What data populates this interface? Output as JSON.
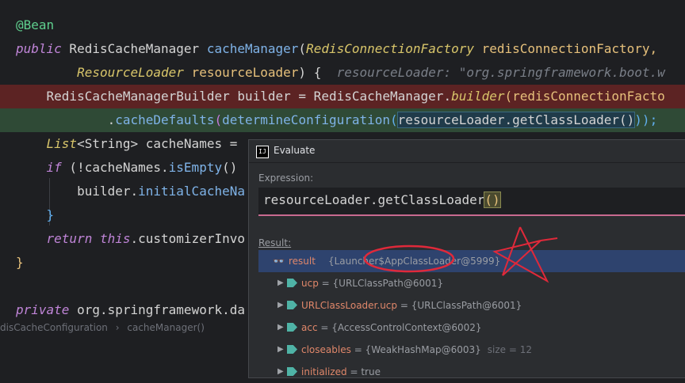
{
  "editor": {
    "lines": [
      {
        "parts": [
          {
            "t": "@Bean",
            "c": "ann"
          }
        ]
      },
      {
        "parts": [
          {
            "t": "public",
            "c": "kw"
          },
          {
            "t": " RedisCacheManager ",
            "c": "punct"
          },
          {
            "t": "cacheManager",
            "c": "method"
          },
          {
            "t": "(",
            "c": "punct"
          },
          {
            "t": "RedisConnectionFactory",
            "c": "type"
          },
          {
            "t": " redisConnectionFactory,",
            "c": "ident"
          }
        ]
      },
      {
        "parts": [
          {
            "t": "        "
          },
          {
            "t": "ResourceLoader",
            "c": "type"
          },
          {
            "t": " resourceLoader",
            "c": "ident"
          },
          {
            "t": ") {  ",
            "c": "punct"
          },
          {
            "t": "resourceLoader: \"org.springframework.boot.w",
            "c": "hint"
          }
        ]
      },
      {
        "bg": "red",
        "parts": [
          {
            "t": "    RedisCacheManagerBuilder builder = RedisCacheManager.",
            "c": "punct"
          },
          {
            "t": "builder",
            "c": "type"
          },
          {
            "t": "(",
            "c": "paren-y"
          },
          {
            "t": "redisConnectionFacto",
            "c": "ident"
          }
        ]
      },
      {
        "bg": "green",
        "parts": [
          {
            "t": "            .",
            "c": "punct"
          },
          {
            "t": "cacheDefaults",
            "c": "method"
          },
          {
            "t": "(",
            "c": "paren-p"
          },
          {
            "t": "determineConfiguration",
            "c": "method"
          },
          {
            "t": "(",
            "c": "paren-b"
          },
          {
            "t": "resourceLoader.getClassLoader()",
            "c": "sel"
          },
          {
            "t": "));",
            "c": "paren-b"
          }
        ]
      },
      {
        "parts": [
          {
            "t": "    "
          },
          {
            "t": "List",
            "c": "type"
          },
          {
            "t": "<String> cacheNames = ",
            "c": "punct"
          }
        ]
      },
      {
        "parts": [
          {
            "t": "    "
          },
          {
            "t": "if",
            "c": "kw"
          },
          {
            "t": " (!cacheNames.",
            "c": "punct"
          },
          {
            "t": "isEmpty",
            "c": "method"
          },
          {
            "t": "()",
            "c": "punct"
          }
        ]
      },
      {
        "parts": [
          {
            "t": "        builder.",
            "c": "punct"
          },
          {
            "t": "initialCacheNa",
            "c": "method"
          }
        ]
      },
      {
        "parts": [
          {
            "t": "    }",
            "c": "paren-b"
          }
        ]
      },
      {
        "parts": [
          {
            "t": "    "
          },
          {
            "t": "return",
            "c": "kw"
          },
          {
            "t": " ",
            "c": "punct"
          },
          {
            "t": "this",
            "c": "kw"
          },
          {
            "t": ".customizerInvo",
            "c": "punct"
          }
        ]
      },
      {
        "parts": [
          {
            "t": "}",
            "c": "paren-y"
          }
        ]
      },
      {
        "parts": []
      },
      {
        "parts": [
          {
            "t": "private",
            "c": "kw"
          },
          {
            "t": " org.springframework.da",
            "c": "punct"
          }
        ]
      }
    ]
  },
  "breadcrumbs": [
    "disCacheConfiguration",
    "›",
    "cacheManager()"
  ],
  "evaluate": {
    "title": "Evaluate",
    "app_icon": "intellij-icon",
    "expression_label": "Expression:",
    "expression_main": "resourceLoader.getClassLoader",
    "expression_bracket": "()",
    "result_label": "Result:",
    "result": {
      "name": "result",
      "value": "{Launcher$AppClassLoader@5999}"
    },
    "fields": [
      {
        "name": "ucp",
        "value": "= {URLClassPath@6001}",
        "extra": ""
      },
      {
        "name": "URLClassLoader.ucp",
        "value": "= {URLClassPath@6001}",
        "extra": ""
      },
      {
        "name": "acc",
        "value": "= {AccessControlContext@6002}",
        "extra": ""
      },
      {
        "name": "closeables",
        "value": "= {WeakHashMap@6003}",
        "extra": "size = 12"
      },
      {
        "name": "initialized",
        "value": "= true",
        "extra": ""
      }
    ]
  },
  "colors": {
    "accent_red": "#e0293a",
    "selection": "#2e436e",
    "diff_removed": "#5c2323",
    "diff_added": "#2f4a36"
  }
}
